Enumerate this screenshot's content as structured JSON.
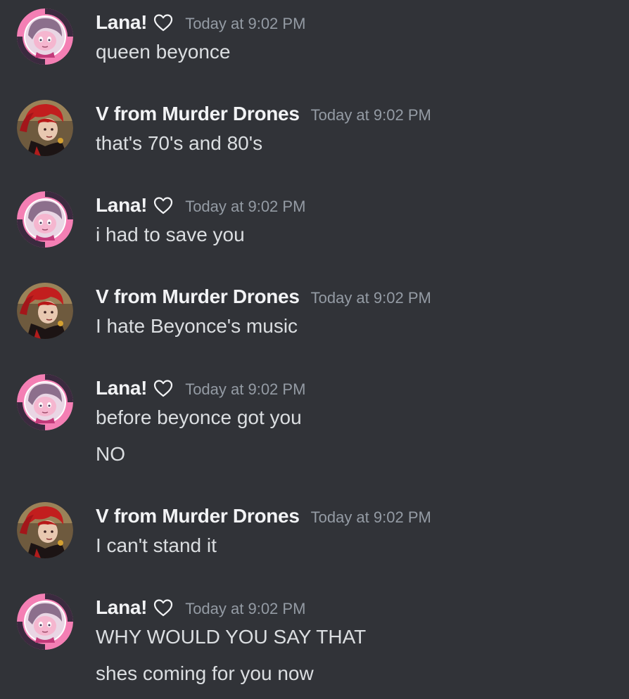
{
  "messages": [
    {
      "author": "Lana!",
      "author_type": "lana",
      "timestamp": "Today at 9:02 PM",
      "lines": [
        "queen beyonce"
      ]
    },
    {
      "author": "V from Murder Drones",
      "author_type": "v",
      "timestamp": "Today at 9:02 PM",
      "lines": [
        "that's 70's and 80's"
      ]
    },
    {
      "author": "Lana!",
      "author_type": "lana",
      "timestamp": "Today at 9:02 PM",
      "lines": [
        "i had to save you"
      ]
    },
    {
      "author": "V from Murder Drones",
      "author_type": "v",
      "timestamp": "Today at 9:02 PM",
      "lines": [
        "I hate Beyonce's music"
      ]
    },
    {
      "author": "Lana!",
      "author_type": "lana",
      "timestamp": "Today at 9:02 PM",
      "lines": [
        "before beyonce got you",
        "NO"
      ]
    },
    {
      "author": "V from Murder Drones",
      "author_type": "v",
      "timestamp": "Today at 9:02 PM",
      "lines": [
        "I can't stand it"
      ]
    },
    {
      "author": "Lana!",
      "author_type": "lana",
      "timestamp": "Today at 9:02 PM",
      "lines": [
        "WHY WOULD YOU SAY THAT",
        "shes coming for you now"
      ]
    }
  ],
  "icons": {
    "author_badge": "heart-outline-icon"
  },
  "colors": {
    "background": "#313338",
    "username": "#f2f3f5",
    "message_text": "#dbdee1",
    "timestamp": "#949ba4",
    "lana_ring_pink": "#f47fb4",
    "lana_ring_dark": "#3b2a3f"
  }
}
